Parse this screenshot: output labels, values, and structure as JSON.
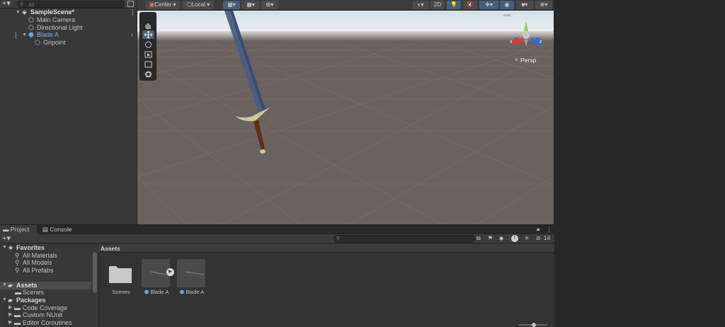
{
  "hierarchy": {
    "search_placeholder": "All",
    "scene_name": "SampleScene*",
    "items": [
      {
        "label": "Main Camera"
      },
      {
        "label": "Directional Light"
      },
      {
        "label": "Blade A"
      },
      {
        "label": "Gripoint"
      }
    ]
  },
  "scene_toolbar": {
    "pivot_label": "Center",
    "space_label": "Local",
    "view_2d_label": "2D"
  },
  "scene": {
    "gizmo_x": "x",
    "gizmo_z": "z",
    "projection_label": "Persp"
  },
  "project_panel": {
    "tabs": [
      {
        "label": "Project"
      },
      {
        "label": "Console"
      }
    ],
    "hidden_count": "14",
    "tree": {
      "favorites_label": "Favorites",
      "favorites": [
        {
          "label": "All Materials"
        },
        {
          "label": "All Models"
        },
        {
          "label": "All Prefabs"
        }
      ],
      "assets_label": "Assets",
      "assets_children": [
        {
          "label": "Scenes"
        }
      ],
      "packages_label": "Packages",
      "packages_children": [
        {
          "label": "Code Coverage"
        },
        {
          "label": "Custom NUnit"
        },
        {
          "label": "Editor Coroutines"
        }
      ]
    },
    "breadcrumb": "Assets",
    "assets": [
      {
        "label": "Scenes"
      },
      {
        "label": "Blade A"
      },
      {
        "label": "Blade A"
      }
    ]
  },
  "colors": {
    "selection_blue": "#46607c",
    "prefab_blue": "#6fa3dd",
    "gizmo_x": "#e23c3c",
    "gizmo_y": "#8fd14f",
    "gizmo_z": "#3c6ae2"
  },
  "icons": [
    "plus-icon",
    "search-icon",
    "unity-scene-icon",
    "menu-dots-icon",
    "gameobject-icon",
    "prefab-icon",
    "hand-tool-icon",
    "move-tool-icon",
    "rotate-tool-icon",
    "scale-tool-icon",
    "rect-tool-icon",
    "transform-tool-icon",
    "folder-icon",
    "play-icon",
    "star-icon",
    "lock-icon",
    "eye-icon"
  ]
}
